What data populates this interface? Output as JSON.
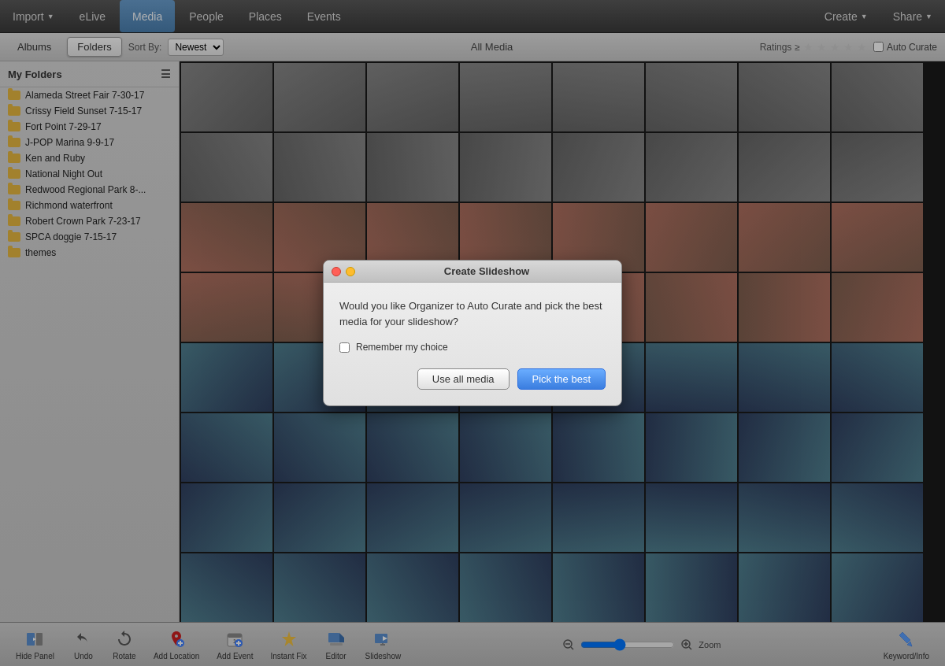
{
  "topnav": {
    "import_label": "Import",
    "elive_label": "eLive",
    "media_label": "Media",
    "people_label": "People",
    "places_label": "Places",
    "events_label": "Events",
    "create_label": "Create",
    "share_label": "Share"
  },
  "toolbar": {
    "albums_label": "Albums",
    "folders_label": "Folders",
    "sort_label": "Sort By:",
    "sort_value": "Newest",
    "all_media_label": "All Media",
    "ratings_label": "Ratings",
    "ratings_gte": "≥",
    "auto_curate_label": "Auto Curate"
  },
  "sidebar": {
    "header_label": "My Folders",
    "items": [
      {
        "label": "Alameda Street Fair 7-30-17"
      },
      {
        "label": "Crissy Field Sunset 7-15-17"
      },
      {
        "label": "Fort Point 7-29-17"
      },
      {
        "label": "J-POP Marina 9-9-17"
      },
      {
        "label": "Ken and Ruby"
      },
      {
        "label": "National Night Out"
      },
      {
        "label": "Redwood Regional Park 8-..."
      },
      {
        "label": "Richmond waterfront"
      },
      {
        "label": "Robert Crown Park 7-23-17"
      },
      {
        "label": "SPCA doggie 7-15-17"
      },
      {
        "label": "themes"
      }
    ]
  },
  "dialog": {
    "title": "Create Slideshow",
    "message": "Would you like Organizer to Auto Curate and pick the best media for your slideshow?",
    "checkbox_label": "Remember my choice",
    "use_all_label": "Use all media",
    "pick_best_label": "Pick the best"
  },
  "bottom_toolbar": {
    "hide_panel_label": "Hide Panel",
    "undo_label": "Undo",
    "rotate_label": "Rotate",
    "add_location_label": "Add Location",
    "add_event_label": "Add Event",
    "instant_fix_label": "Instant Fix",
    "editor_label": "Editor",
    "slideshow_label": "Slideshow",
    "zoom_label": "Zoom",
    "keyword_info_label": "Keyword/Info"
  }
}
